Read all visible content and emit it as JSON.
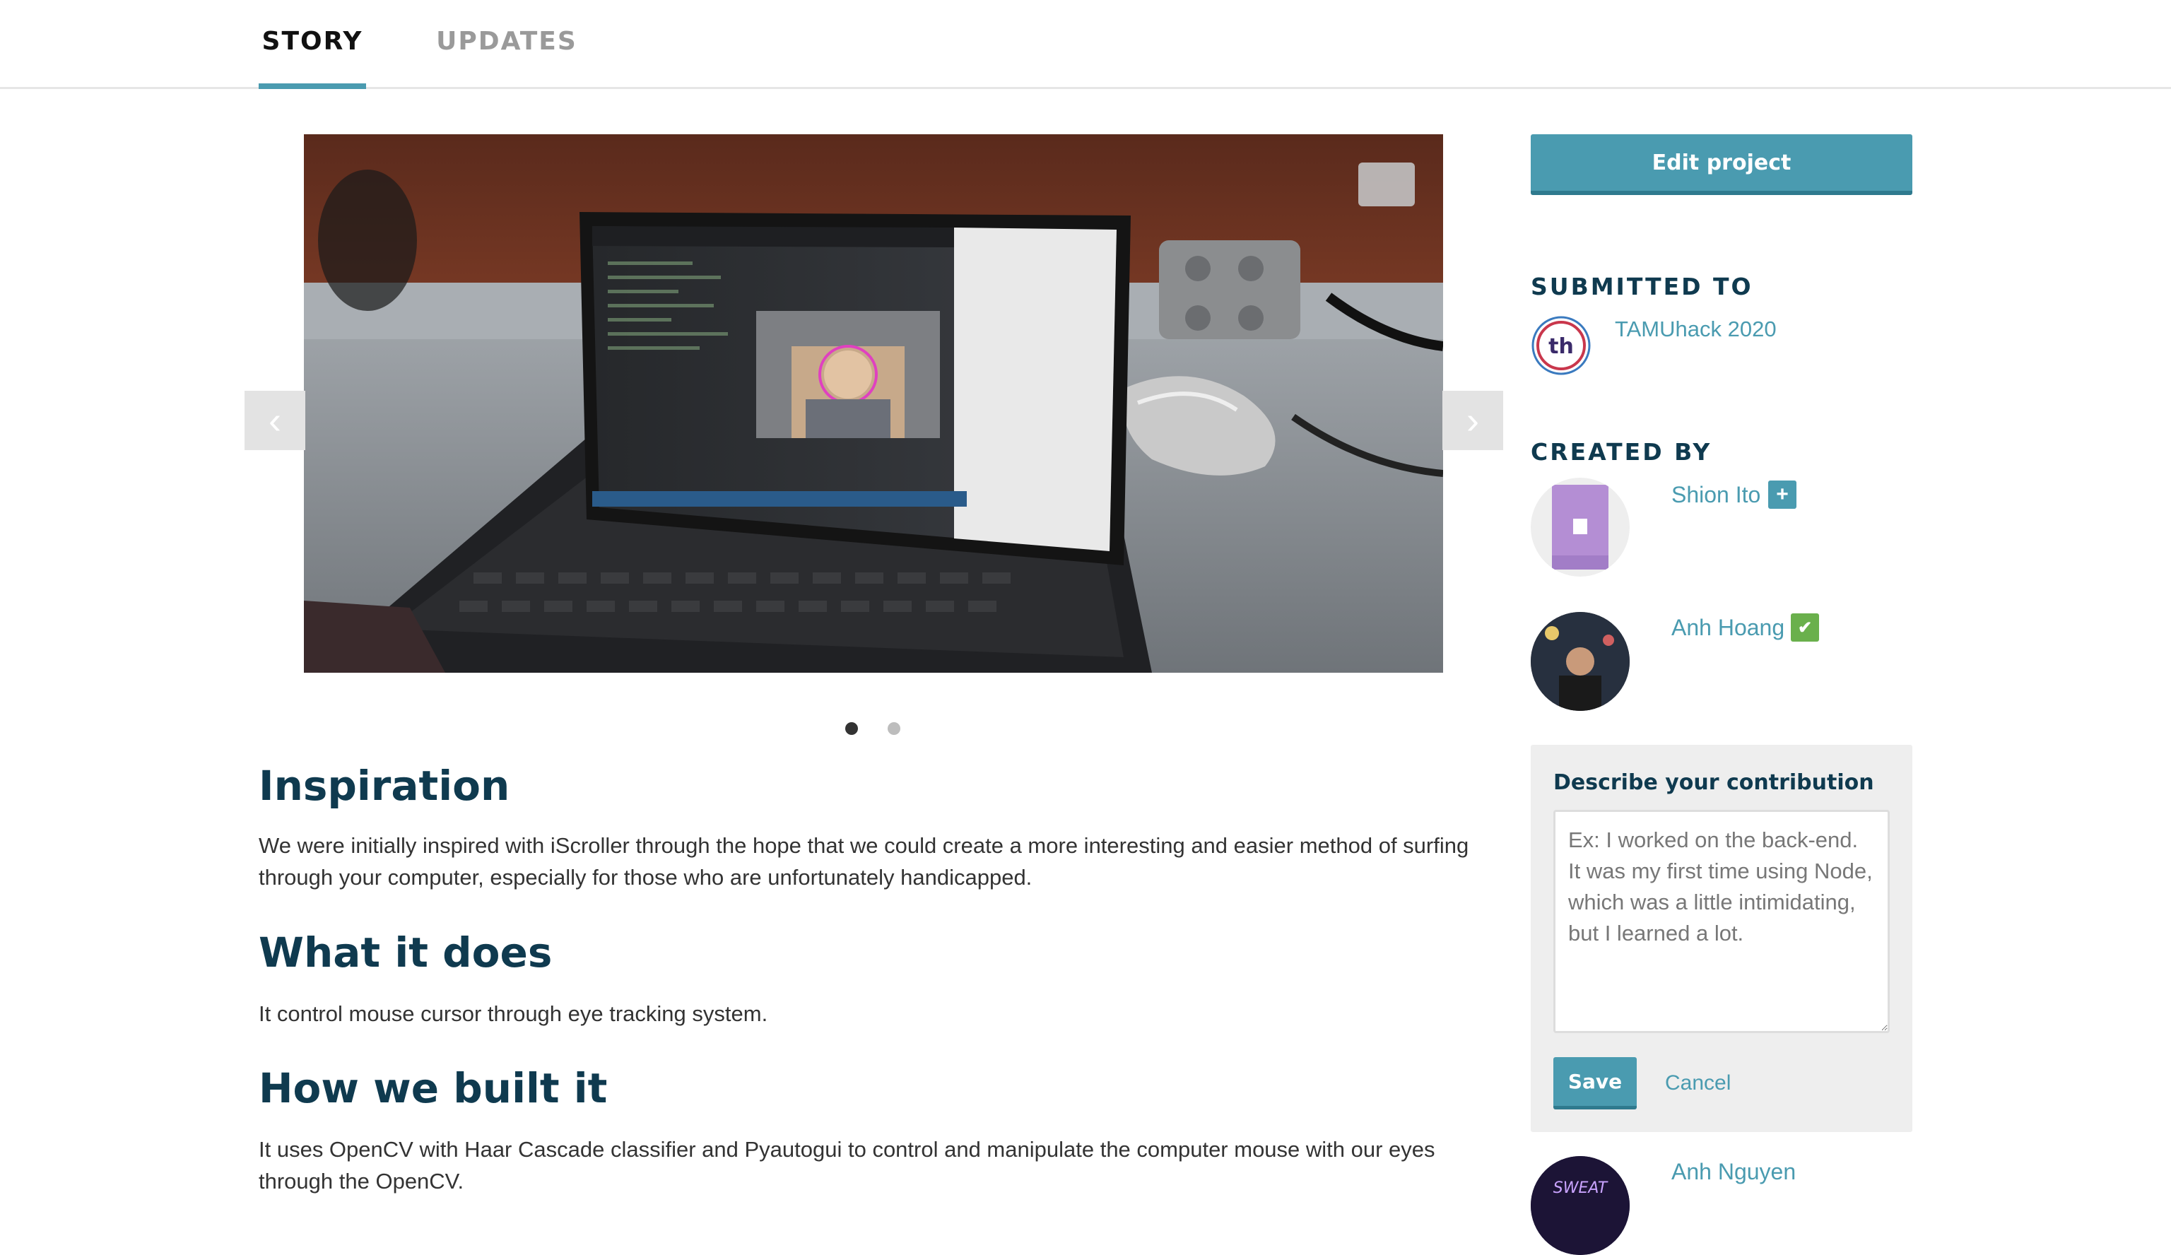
{
  "tabs": [
    {
      "label": "STORY",
      "active": true
    },
    {
      "label": "UPDATES",
      "active": false
    }
  ],
  "carousel": {
    "slide_count": 2,
    "active_slide": 1,
    "prev_icon": "chevron-left-icon",
    "next_icon": "chevron-right-icon",
    "expand_icon": "expand-icon"
  },
  "story": {
    "inspiration_heading": "Inspiration",
    "inspiration_text": "We were initially inspired with iScroller through the hope that we could create a more interesting and easier method of surfing through your computer, especially for those who are unfortunately handicapped.",
    "what_heading": "What it does",
    "what_text": "It control mouse cursor through eye tracking system.",
    "how_heading": "How we built it",
    "how_text": "It uses OpenCV with Haar Cascade classifier and Pyautogui to control and manipulate the computer mouse with our eyes through the OpenCV."
  },
  "sidebar": {
    "edit_button": "Edit project",
    "submitted_heading": "SUBMITTED TO",
    "hackathon": {
      "name": "TAMUhack 2020",
      "logo_text": "th"
    },
    "created_heading": "CREATED BY",
    "members": [
      {
        "name": "Shion Ito",
        "badge": "+"
      },
      {
        "name": "Anh Hoang",
        "badge": "✔"
      },
      {
        "name": "Anh Nguyen",
        "avatar_text": "SWEAT"
      }
    ],
    "contribution": {
      "title": "Describe your contribution",
      "placeholder": "Ex: I worked on the back-end. It was my first time using Node, which was a little intimidating, but I learned a lot.",
      "save_label": "Save",
      "cancel_label": "Cancel"
    }
  },
  "colors": {
    "accent": "#4a9bb0",
    "heading": "#0f3a4f",
    "verified": "#6ab04c"
  }
}
